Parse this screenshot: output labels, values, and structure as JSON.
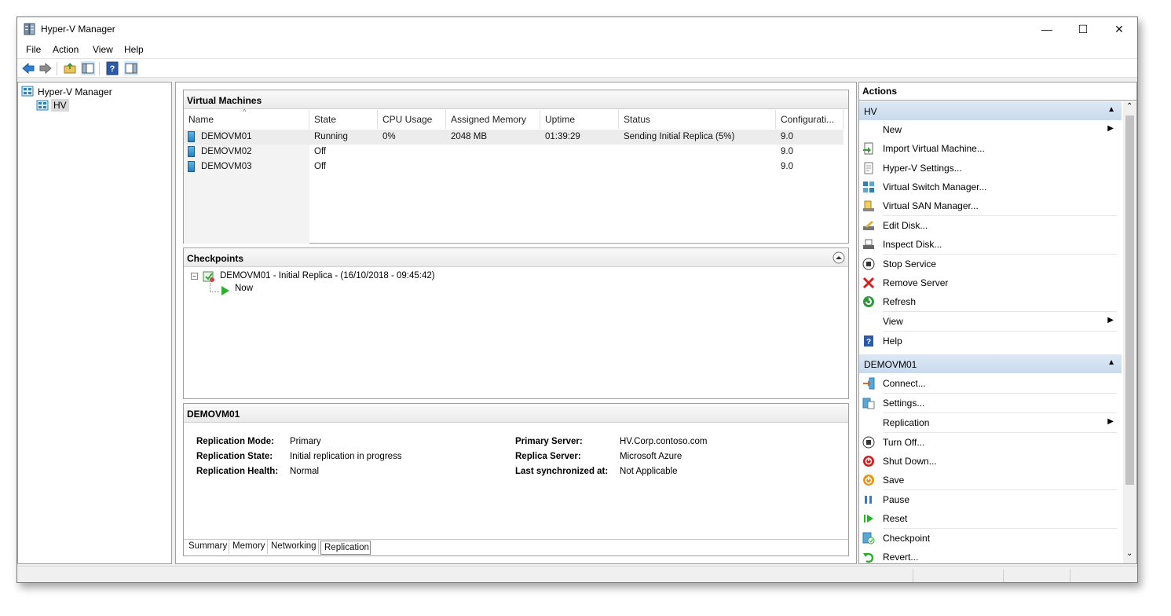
{
  "window": {
    "title": "Hyper-V Manager",
    "controls": {
      "minimize": "—",
      "maximize": "☐",
      "close": "✕"
    }
  },
  "menu": [
    {
      "label": "File"
    },
    {
      "label": "Action"
    },
    {
      "label": "View"
    },
    {
      "label": "Help"
    }
  ],
  "toolbar": [
    "back-icon",
    "forward-icon",
    "up-folder-icon",
    "show-hide-tree-icon",
    "help-icon",
    "show-hide-action-pane-icon"
  ],
  "tree": {
    "root": "Hyper-V Manager",
    "host": "HV"
  },
  "vms": {
    "title": "Virtual Machines",
    "columns": [
      "Name",
      "State",
      "CPU Usage",
      "Assigned Memory",
      "Uptime",
      "Status",
      "Configurati..."
    ],
    "rows": [
      {
        "name": "DEMOVM01",
        "state": "Running",
        "cpu": "0%",
        "memory": "2048 MB",
        "uptime": "01:39:29",
        "status": "Sending Initial Replica (5%)",
        "config": "9.0"
      },
      {
        "name": "DEMOVM02",
        "state": "Off",
        "cpu": "",
        "memory": "",
        "uptime": "",
        "status": "",
        "config": "9.0"
      },
      {
        "name": "DEMOVM03",
        "state": "Off",
        "cpu": "",
        "memory": "",
        "uptime": "",
        "status": "",
        "config": "9.0"
      }
    ]
  },
  "checkpoints": {
    "title": "Checkpoints",
    "root": "DEMOVM01 - Initial Replica - (16/10/2018 - 09:45:42)",
    "now": "Now"
  },
  "details": {
    "title": "DEMOVM01",
    "left": [
      {
        "label": "Replication Mode:",
        "value": "Primary"
      },
      {
        "label": "Replication State:",
        "value": "Initial replication in progress"
      },
      {
        "label": "Replication Health:",
        "value": "Normal"
      }
    ],
    "right": [
      {
        "label": "Primary Server:",
        "value": "HV.Corp.contoso.com"
      },
      {
        "label": "Replica Server:",
        "value": "Microsoft Azure"
      },
      {
        "label": "Last synchronized at:",
        "value": "Not Applicable"
      }
    ],
    "tabs": [
      "Summary",
      "Memory",
      "Networking",
      "Replication"
    ],
    "active_tab": "Replication"
  },
  "actions": {
    "title": "Actions",
    "host_section": "HV",
    "host_items": [
      {
        "label": "New",
        "icon": "none",
        "submenu": true
      },
      {
        "label": "Import Virtual Machine...",
        "icon": "import-vm-icon"
      },
      {
        "label": "Hyper-V Settings...",
        "icon": "settings-doc-icon"
      },
      {
        "label": "Virtual Switch Manager...",
        "icon": "switch-icon"
      },
      {
        "label": "Virtual SAN Manager...",
        "icon": "san-icon"
      },
      {
        "label": "Edit Disk...",
        "icon": "edit-disk-icon"
      },
      {
        "label": "Inspect Disk...",
        "icon": "inspect-disk-icon"
      },
      {
        "label": "Stop Service",
        "icon": "stop-icon"
      },
      {
        "label": "Remove Server",
        "icon": "remove-icon"
      },
      {
        "label": "Refresh",
        "icon": "refresh-icon"
      },
      {
        "label": "View",
        "icon": "none",
        "submenu": true
      },
      {
        "label": "Help",
        "icon": "help-icon"
      }
    ],
    "vm_section": "DEMOVM01",
    "vm_items": [
      {
        "label": "Connect...",
        "icon": "connect-icon"
      },
      {
        "label": "Settings...",
        "icon": "vm-settings-icon"
      },
      {
        "label": "Replication",
        "icon": "none",
        "submenu": true
      },
      {
        "label": "Turn Off...",
        "icon": "turn-off-icon"
      },
      {
        "label": "Shut Down...",
        "icon": "shutdown-icon"
      },
      {
        "label": "Save",
        "icon": "save-icon"
      },
      {
        "label": "Pause",
        "icon": "pause-icon"
      },
      {
        "label": "Reset",
        "icon": "reset-icon"
      },
      {
        "label": "Checkpoint",
        "icon": "checkpoint-icon"
      },
      {
        "label": "Revert...",
        "icon": "revert-icon"
      }
    ]
  },
  "colors": {
    "section_header": "#c9daee",
    "selection": "#cce8ff",
    "running_green": "#2eae2e"
  }
}
